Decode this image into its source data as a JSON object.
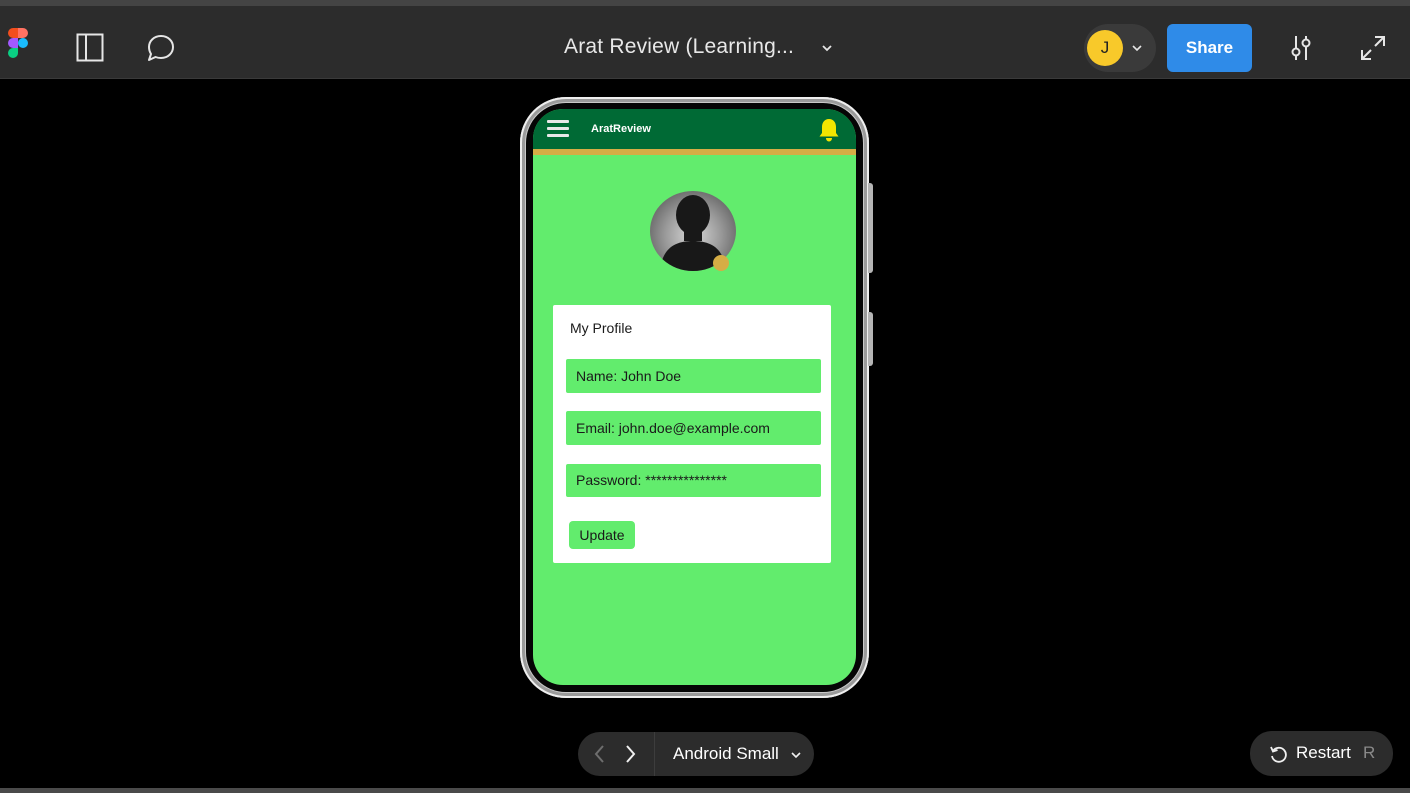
{
  "toolbar": {
    "doc_title": "Arat Review (Learning...",
    "avatar_initial": "J",
    "share_label": "Share"
  },
  "app": {
    "name": "AratReview",
    "colors": {
      "header": "#006a35",
      "header_accent": "#d5ad45",
      "background": "#62ec6d",
      "bell": "#f3e600"
    }
  },
  "profile": {
    "title": "My Profile",
    "name_field": "Name: John Doe",
    "email_field": "Email: john.doe@example.com",
    "password_field": "Password: ***************",
    "update_label": "Update"
  },
  "player": {
    "device_label": "Android Small",
    "restart_label": "Restart",
    "restart_shortcut": "R"
  }
}
